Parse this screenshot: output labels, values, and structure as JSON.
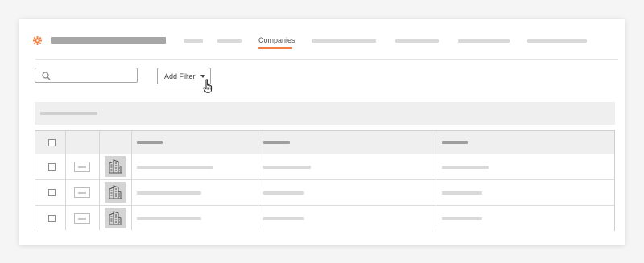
{
  "nav": {
    "active_tab": "Companies",
    "accent_color": "#f47e42",
    "logo_icon": "gear-icon"
  },
  "toolbar": {
    "search_placeholder": "",
    "add_filter_label": "Add Filter"
  },
  "table": {
    "row_count": 3,
    "row_icon": "building-icon"
  }
}
